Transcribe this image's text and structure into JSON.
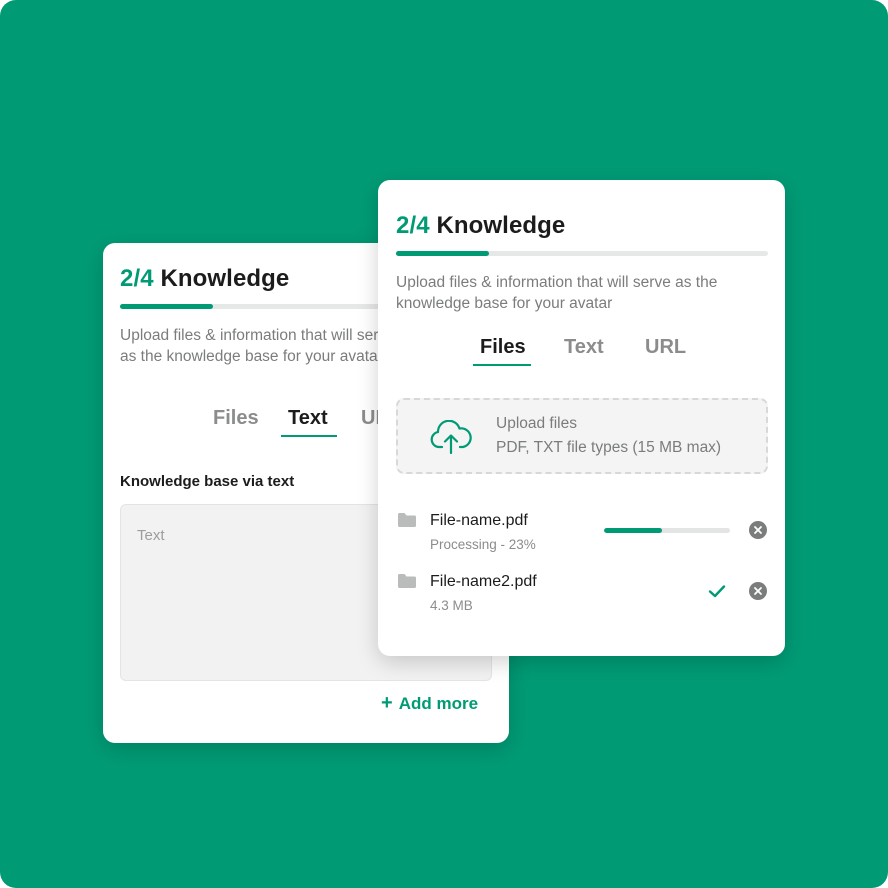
{
  "back_card": {
    "step": "2/4",
    "title": "Knowledge",
    "progress_fraction": 0.25,
    "description": "Upload files & information that will serve as the knowledge base for your avatar",
    "tabs": [
      "Files",
      "Text",
      "URL"
    ],
    "active_tab": "Text",
    "section_label": "Knowledge base via text",
    "text_placeholder": "Text",
    "add_more_label": "Add more"
  },
  "front_card": {
    "step": "2/4",
    "title": "Knowledge",
    "progress_fraction": 0.25,
    "description_line1": "Upload files & information that will serve as the",
    "description_line2": "knowledge base for your avatar",
    "tabs": [
      "Files",
      "Text",
      "URL"
    ],
    "active_tab": "Files",
    "upload": {
      "title": "Upload files",
      "subtitle": "PDF, TXT file types (15 MB max)",
      "icon": "cloud-upload-icon"
    },
    "files": [
      {
        "name": "File-name.pdf",
        "meta": "Processing - 23%",
        "progress": 0.23,
        "status": "processing"
      },
      {
        "name": "File-name2.pdf",
        "meta": "4.3 MB",
        "status": "done"
      }
    ]
  },
  "colors": {
    "brand": "#009b75",
    "background": "#009b75",
    "text": "#1c1c1c",
    "muted": "#7a7d7c"
  }
}
